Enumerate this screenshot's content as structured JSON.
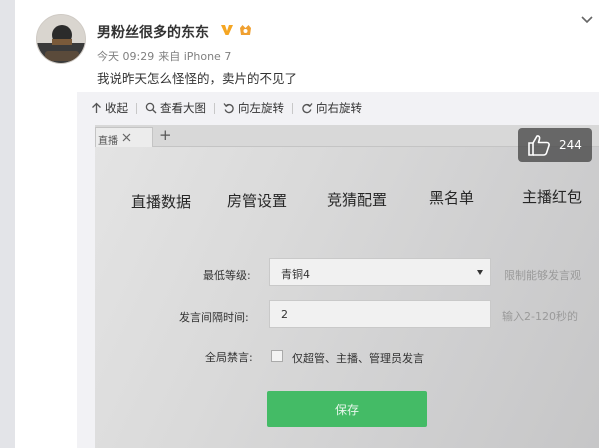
{
  "post": {
    "username": "男粉丝很多的东东",
    "time": "今天 09:29",
    "source": "来自 iPhone 7",
    "text": "我说昨天怎么怪怪的，卖片的不见了"
  },
  "toolbar": {
    "collapse_label": "收起",
    "view_large_label": "查看大图",
    "rotate_left_label": "向左旋转",
    "rotate_right_label": "向右旋转"
  },
  "likes": {
    "count": "244"
  },
  "photo": {
    "tab_label": "直播",
    "tab_plus": "+",
    "nav_items": [
      "直播数据",
      "房管设置",
      "竞猜配置",
      "黑名单",
      "主播红包"
    ],
    "form": {
      "min_level_label": "最低等级:",
      "min_level_value": "青铜4",
      "min_level_hint": "限制能够发言观",
      "interval_label": "发言间隔时间:",
      "interval_value": "2",
      "interval_hint": "输入2-120秒的",
      "global_mute_label": "全局禁言:",
      "global_mute_option": "仅超管、主播、管理员发言",
      "save_label": "保存"
    }
  },
  "colors": {
    "vip_badge": "#f5a623",
    "save_button": "#44bb66"
  },
  "icons": [
    "avatar",
    "vip-icon",
    "member-icon",
    "chevron-down-icon",
    "collapse-icon",
    "magnifier-icon",
    "rotate-left-icon",
    "rotate-right-icon",
    "thumbs-up-icon"
  ]
}
